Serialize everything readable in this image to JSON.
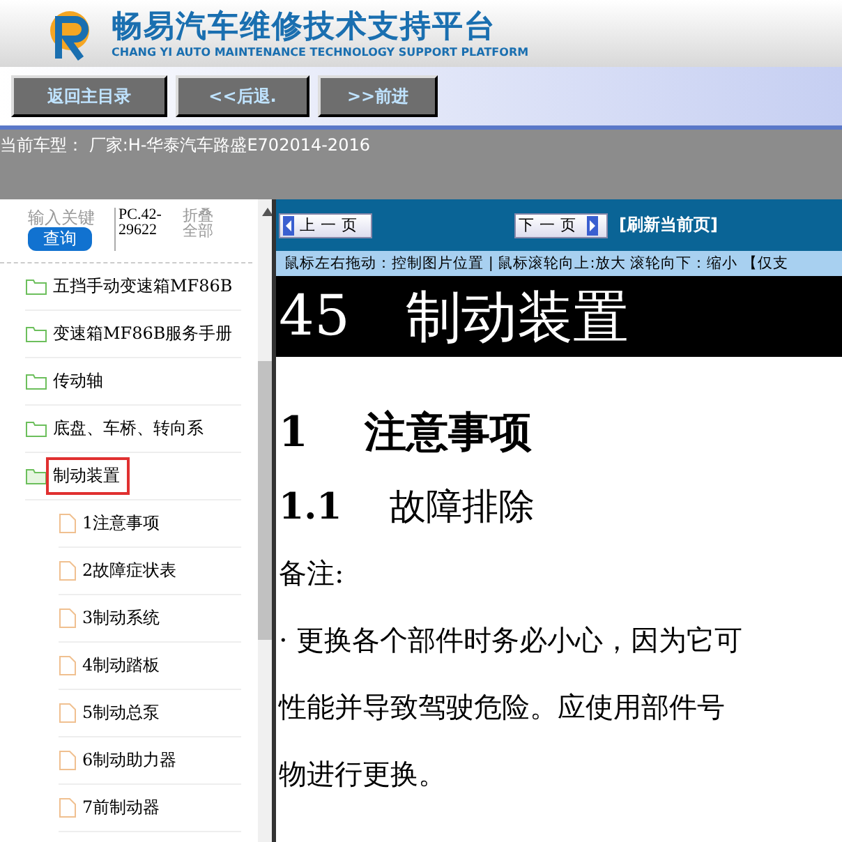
{
  "header": {
    "title": "畅易汽车维修技术支持平台",
    "subtitle": "CHANG YI AUTO MAINTENANCE TECHNOLOGY SUPPORT PLATFORM"
  },
  "nav_buttons": [
    "返回主目录",
    "<<后退.",
    ">>前进"
  ],
  "current_model": "当前车型：  厂家:H-华泰汽车路盛E702014-2016",
  "sidebar": {
    "search": {
      "placeholder": "输入关键",
      "button": "查询"
    },
    "code": "PC.42-29622",
    "collapse": "折叠全部",
    "items": [
      {
        "label": "五挡手动变速箱MF86B",
        "selected": false,
        "expanded": false
      },
      {
        "label": "变速箱MF86B服务手册",
        "selected": false,
        "expanded": false
      },
      {
        "label": "传动轴",
        "selected": false,
        "expanded": false
      },
      {
        "label": "底盘、车桥、转向系",
        "selected": false,
        "expanded": false
      },
      {
        "label": "制动装置",
        "selected": true,
        "expanded": true,
        "children": [
          {
            "label": "1注意事项"
          },
          {
            "label": "2故障症状表"
          },
          {
            "label": "3制动系统"
          },
          {
            "label": "4制动踏板"
          },
          {
            "label": "5制动总泵"
          },
          {
            "label": "6制动助力器"
          },
          {
            "label": "7前制动器"
          }
        ]
      }
    ]
  },
  "viewer": {
    "prev": "上一页",
    "next": "下一页",
    "refresh": "[刷新当前页]",
    "hint": "鼠标左右拖动：控制图片位置 | 鼠标滚轮向上:放大   滚轮向下：缩小 【仅支",
    "document": {
      "chapter_number": "45",
      "chapter_title": "制动装置",
      "blocks": [
        {
          "kind": "h1",
          "number": "1",
          "text": "注意事项"
        },
        {
          "kind": "h2",
          "number": "1.1",
          "text": "故障排除"
        },
        {
          "kind": "p",
          "text": "备注:"
        },
        {
          "kind": "p",
          "text": "· 更换各个部件时务必小心，因为它可"
        },
        {
          "kind": "p",
          "text": "性能并导致驾驶危险。应使用部件号"
        },
        {
          "kind": "p",
          "text": "物进行更换。"
        }
      ]
    }
  }
}
